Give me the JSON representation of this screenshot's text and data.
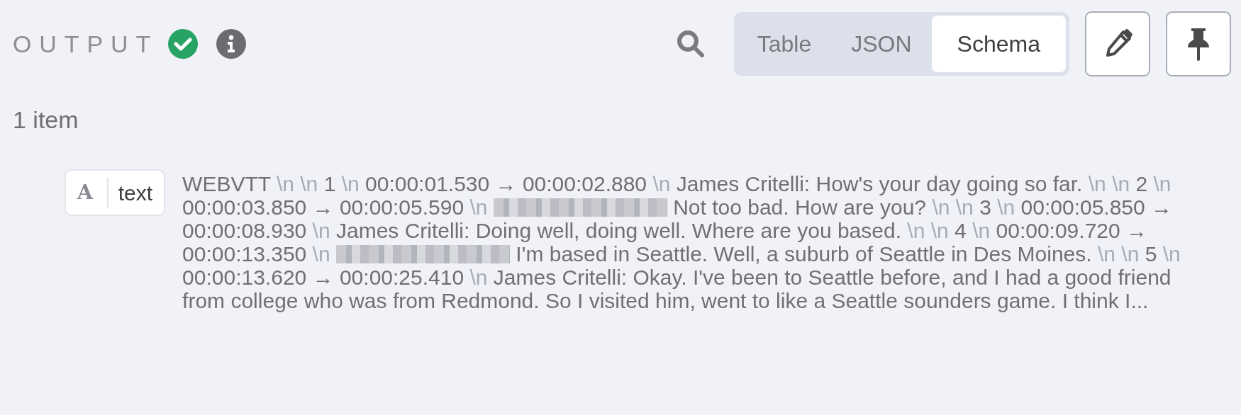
{
  "header": {
    "title": "OUTPUT"
  },
  "view_tabs": [
    {
      "label": "Table",
      "selected": false
    },
    {
      "label": "JSON",
      "selected": false
    },
    {
      "label": "Schema",
      "selected": true
    }
  ],
  "item_count": "1 item",
  "items": [
    {
      "type_letter": "A",
      "field_name": "text",
      "value": [
        {
          "kind": "text",
          "text": "WEBVTT"
        },
        {
          "kind": "newline",
          "text": "\\n"
        },
        {
          "kind": "newline",
          "text": "\\n"
        },
        {
          "kind": "text",
          "text": "1"
        },
        {
          "kind": "newline",
          "text": "\\n"
        },
        {
          "kind": "text",
          "text": "00:00:01.530 → 00:00:02.880"
        },
        {
          "kind": "newline",
          "text": "\\n"
        },
        {
          "kind": "text",
          "text": "James Critelli: How's your day going so far."
        },
        {
          "kind": "newline",
          "text": "\\n"
        },
        {
          "kind": "newline",
          "text": "\\n"
        },
        {
          "kind": "text",
          "text": "2"
        },
        {
          "kind": "newline",
          "text": "\\n"
        },
        {
          "kind": "text",
          "text": "00:00:03.850 → 00:00:05.590"
        },
        {
          "kind": "newline",
          "text": "\\n"
        },
        {
          "kind": "redacted"
        },
        {
          "kind": "text",
          "text": "Not too bad. How are you?"
        },
        {
          "kind": "newline",
          "text": "\\n"
        },
        {
          "kind": "newline",
          "text": "\\n"
        },
        {
          "kind": "text",
          "text": "3"
        },
        {
          "kind": "newline",
          "text": "\\n"
        },
        {
          "kind": "text",
          "text": "00:00:05.850 → 00:00:08.930"
        },
        {
          "kind": "newline",
          "text": "\\n"
        },
        {
          "kind": "text",
          "text": "James Critelli: Doing well, doing well. Where are you based."
        },
        {
          "kind": "newline",
          "text": "\\n"
        },
        {
          "kind": "newline",
          "text": "\\n"
        },
        {
          "kind": "text",
          "text": "4"
        },
        {
          "kind": "newline",
          "text": "\\n"
        },
        {
          "kind": "text",
          "text": "00:00:09.720 → 00:00:13.350"
        },
        {
          "kind": "newline",
          "text": "\\n"
        },
        {
          "kind": "redacted"
        },
        {
          "kind": "text",
          "text": "I'm based in Seattle. Well, a suburb of Seattle in Des Moines."
        },
        {
          "kind": "newline",
          "text": "\\n"
        },
        {
          "kind": "newline",
          "text": "\\n"
        },
        {
          "kind": "text",
          "text": "5"
        },
        {
          "kind": "newline",
          "text": "\\n"
        },
        {
          "kind": "text",
          "text": "00:00:13.620 → 00:00:25.410"
        },
        {
          "kind": "newline",
          "text": "\\n"
        },
        {
          "kind": "text",
          "text": "James Critelli: Okay. I've been to Seattle before, and I had a good friend from college who was from Redmond. So I visited him, went to like a Seattle sounders game. I think I..."
        }
      ]
    }
  ]
}
